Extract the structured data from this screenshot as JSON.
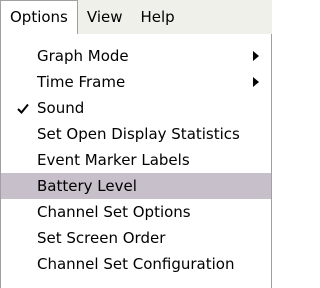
{
  "menubar": {
    "items": [
      {
        "label": "Options"
      },
      {
        "label": "View"
      },
      {
        "label": "Help"
      }
    ]
  },
  "options_menu": {
    "items": [
      {
        "label": "Graph Mode",
        "submenu": true,
        "checked": false
      },
      {
        "label": "Time Frame",
        "submenu": true,
        "checked": false
      },
      {
        "label": "Sound",
        "submenu": false,
        "checked": true
      },
      {
        "label": "Set Open Display Statistics",
        "submenu": false,
        "checked": false
      },
      {
        "label": "Event Marker Labels",
        "submenu": false,
        "checked": false
      },
      {
        "label": "Battery Level",
        "submenu": false,
        "checked": false,
        "highlighted": true
      },
      {
        "label": "Channel Set Options",
        "submenu": false,
        "checked": false
      },
      {
        "label": "Set Screen Order",
        "submenu": false,
        "checked": false
      },
      {
        "label": "Channel Set Configuration",
        "submenu": false,
        "checked": false
      }
    ]
  },
  "colors": {
    "menubar_bg": "#f0f0ea",
    "highlight_bg": "#c7bfc9",
    "border": "#a0a0a0"
  },
  "icons": {
    "check": "check-icon",
    "submenu": "submenu-arrow-icon"
  }
}
